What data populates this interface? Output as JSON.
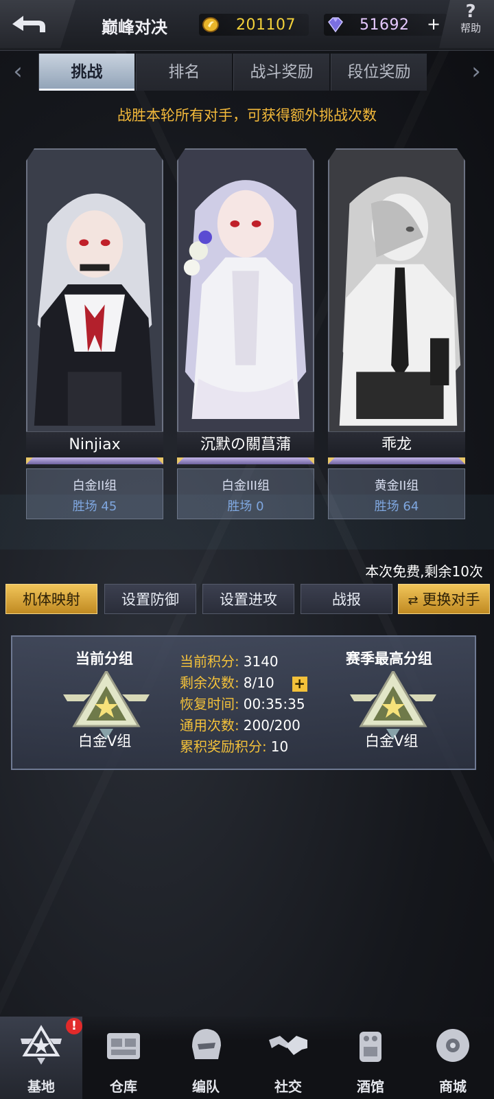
{
  "header": {
    "title": "巅峰对决",
    "coins": "201107",
    "gems": "51692",
    "plus": "+",
    "help_label": "帮助",
    "help_glyph": "?"
  },
  "tabs": [
    {
      "label": "挑战",
      "active": true
    },
    {
      "label": "排名",
      "active": false
    },
    {
      "label": "战斗奖励",
      "active": false
    },
    {
      "label": "段位奖励",
      "active": false
    }
  ],
  "notice": "战胜本轮所有对手，可获得额外挑战次数",
  "opponents": [
    {
      "name": "Ninjiax",
      "tier": "白金II组",
      "wins": "胜场 45"
    },
    {
      "name": "沉默の關菖蒲",
      "tier": "白金III组",
      "wins": "胜场 0"
    },
    {
      "name": "乖龙",
      "tier": "黄金II组",
      "wins": "胜场 64"
    }
  ],
  "free_note": "本次免费,剩余10次",
  "actions": [
    {
      "label": "机体映射",
      "style": "gold"
    },
    {
      "label": "设置防御",
      "style": "normal"
    },
    {
      "label": "设置进攻",
      "style": "normal"
    },
    {
      "label": "战报",
      "style": "normal"
    },
    {
      "label": "更换对手",
      "style": "gold",
      "icon": "swap-icon",
      "glyph": "⇄"
    }
  ],
  "status": {
    "current_group_label": "当前分组",
    "current_group": "白金V组",
    "season_best_label": "赛季最高分组",
    "season_best": "白金V组",
    "stats": [
      {
        "key": "当前积分:",
        "value": "3140"
      },
      {
        "key": "剩余次数:",
        "value": "8/10"
      },
      {
        "key": "恢复时间:",
        "value": "00:35:35"
      },
      {
        "key": "通用次数:",
        "value": "200/200"
      },
      {
        "key": "累积奖励积分:",
        "value": "10"
      }
    ],
    "add_glyph": "+"
  },
  "nav": [
    {
      "label": "基地",
      "icon": "base-star-icon",
      "active": true,
      "badge": "!"
    },
    {
      "label": "仓库",
      "icon": "warehouse-icon",
      "active": false
    },
    {
      "label": "编队",
      "icon": "formation-helmet-icon",
      "active": false
    },
    {
      "label": "社交",
      "icon": "handshake-icon",
      "active": false
    },
    {
      "label": "酒馆",
      "icon": "tavern-icon",
      "active": false
    },
    {
      "label": "商城",
      "icon": "shop-icon",
      "active": false
    }
  ],
  "colors": {
    "accent_gold": "#f3c13a",
    "notice": "#f3b93a",
    "wins": "#7fa7e0"
  }
}
